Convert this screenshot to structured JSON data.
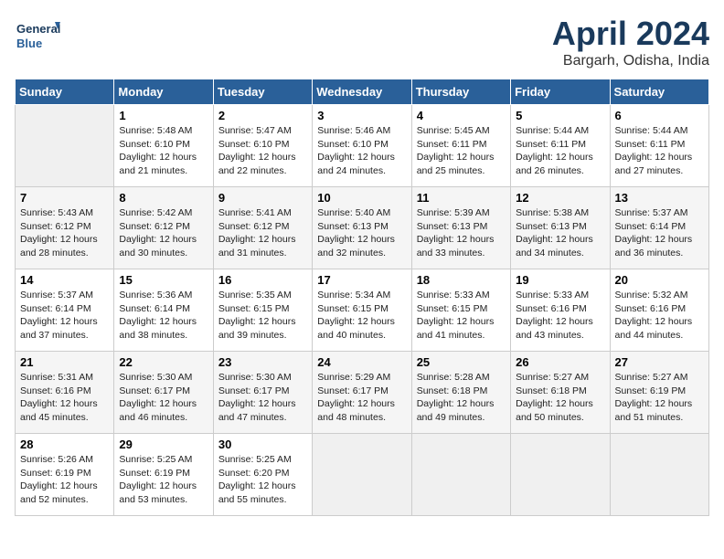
{
  "header": {
    "logo_text_general": "General",
    "logo_text_blue": "Blue",
    "month_title": "April 2024",
    "location": "Bargarh, Odisha, India"
  },
  "days_of_week": [
    "Sunday",
    "Monday",
    "Tuesday",
    "Wednesday",
    "Thursday",
    "Friday",
    "Saturday"
  ],
  "weeks": [
    [
      {
        "day": "",
        "info": ""
      },
      {
        "day": "1",
        "info": "Sunrise: 5:48 AM\nSunset: 6:10 PM\nDaylight: 12 hours\nand 21 minutes."
      },
      {
        "day": "2",
        "info": "Sunrise: 5:47 AM\nSunset: 6:10 PM\nDaylight: 12 hours\nand 22 minutes."
      },
      {
        "day": "3",
        "info": "Sunrise: 5:46 AM\nSunset: 6:10 PM\nDaylight: 12 hours\nand 24 minutes."
      },
      {
        "day": "4",
        "info": "Sunrise: 5:45 AM\nSunset: 6:11 PM\nDaylight: 12 hours\nand 25 minutes."
      },
      {
        "day": "5",
        "info": "Sunrise: 5:44 AM\nSunset: 6:11 PM\nDaylight: 12 hours\nand 26 minutes."
      },
      {
        "day": "6",
        "info": "Sunrise: 5:44 AM\nSunset: 6:11 PM\nDaylight: 12 hours\nand 27 minutes."
      }
    ],
    [
      {
        "day": "7",
        "info": "Sunrise: 5:43 AM\nSunset: 6:12 PM\nDaylight: 12 hours\nand 28 minutes."
      },
      {
        "day": "8",
        "info": "Sunrise: 5:42 AM\nSunset: 6:12 PM\nDaylight: 12 hours\nand 30 minutes."
      },
      {
        "day": "9",
        "info": "Sunrise: 5:41 AM\nSunset: 6:12 PM\nDaylight: 12 hours\nand 31 minutes."
      },
      {
        "day": "10",
        "info": "Sunrise: 5:40 AM\nSunset: 6:13 PM\nDaylight: 12 hours\nand 32 minutes."
      },
      {
        "day": "11",
        "info": "Sunrise: 5:39 AM\nSunset: 6:13 PM\nDaylight: 12 hours\nand 33 minutes."
      },
      {
        "day": "12",
        "info": "Sunrise: 5:38 AM\nSunset: 6:13 PM\nDaylight: 12 hours\nand 34 minutes."
      },
      {
        "day": "13",
        "info": "Sunrise: 5:37 AM\nSunset: 6:14 PM\nDaylight: 12 hours\nand 36 minutes."
      }
    ],
    [
      {
        "day": "14",
        "info": "Sunrise: 5:37 AM\nSunset: 6:14 PM\nDaylight: 12 hours\nand 37 minutes."
      },
      {
        "day": "15",
        "info": "Sunrise: 5:36 AM\nSunset: 6:14 PM\nDaylight: 12 hours\nand 38 minutes."
      },
      {
        "day": "16",
        "info": "Sunrise: 5:35 AM\nSunset: 6:15 PM\nDaylight: 12 hours\nand 39 minutes."
      },
      {
        "day": "17",
        "info": "Sunrise: 5:34 AM\nSunset: 6:15 PM\nDaylight: 12 hours\nand 40 minutes."
      },
      {
        "day": "18",
        "info": "Sunrise: 5:33 AM\nSunset: 6:15 PM\nDaylight: 12 hours\nand 41 minutes."
      },
      {
        "day": "19",
        "info": "Sunrise: 5:33 AM\nSunset: 6:16 PM\nDaylight: 12 hours\nand 43 minutes."
      },
      {
        "day": "20",
        "info": "Sunrise: 5:32 AM\nSunset: 6:16 PM\nDaylight: 12 hours\nand 44 minutes."
      }
    ],
    [
      {
        "day": "21",
        "info": "Sunrise: 5:31 AM\nSunset: 6:16 PM\nDaylight: 12 hours\nand 45 minutes."
      },
      {
        "day": "22",
        "info": "Sunrise: 5:30 AM\nSunset: 6:17 PM\nDaylight: 12 hours\nand 46 minutes."
      },
      {
        "day": "23",
        "info": "Sunrise: 5:30 AM\nSunset: 6:17 PM\nDaylight: 12 hours\nand 47 minutes."
      },
      {
        "day": "24",
        "info": "Sunrise: 5:29 AM\nSunset: 6:17 PM\nDaylight: 12 hours\nand 48 minutes."
      },
      {
        "day": "25",
        "info": "Sunrise: 5:28 AM\nSunset: 6:18 PM\nDaylight: 12 hours\nand 49 minutes."
      },
      {
        "day": "26",
        "info": "Sunrise: 5:27 AM\nSunset: 6:18 PM\nDaylight: 12 hours\nand 50 minutes."
      },
      {
        "day": "27",
        "info": "Sunrise: 5:27 AM\nSunset: 6:19 PM\nDaylight: 12 hours\nand 51 minutes."
      }
    ],
    [
      {
        "day": "28",
        "info": "Sunrise: 5:26 AM\nSunset: 6:19 PM\nDaylight: 12 hours\nand 52 minutes."
      },
      {
        "day": "29",
        "info": "Sunrise: 5:25 AM\nSunset: 6:19 PM\nDaylight: 12 hours\nand 53 minutes."
      },
      {
        "day": "30",
        "info": "Sunrise: 5:25 AM\nSunset: 6:20 PM\nDaylight: 12 hours\nand 55 minutes."
      },
      {
        "day": "",
        "info": ""
      },
      {
        "day": "",
        "info": ""
      },
      {
        "day": "",
        "info": ""
      },
      {
        "day": "",
        "info": ""
      }
    ]
  ]
}
